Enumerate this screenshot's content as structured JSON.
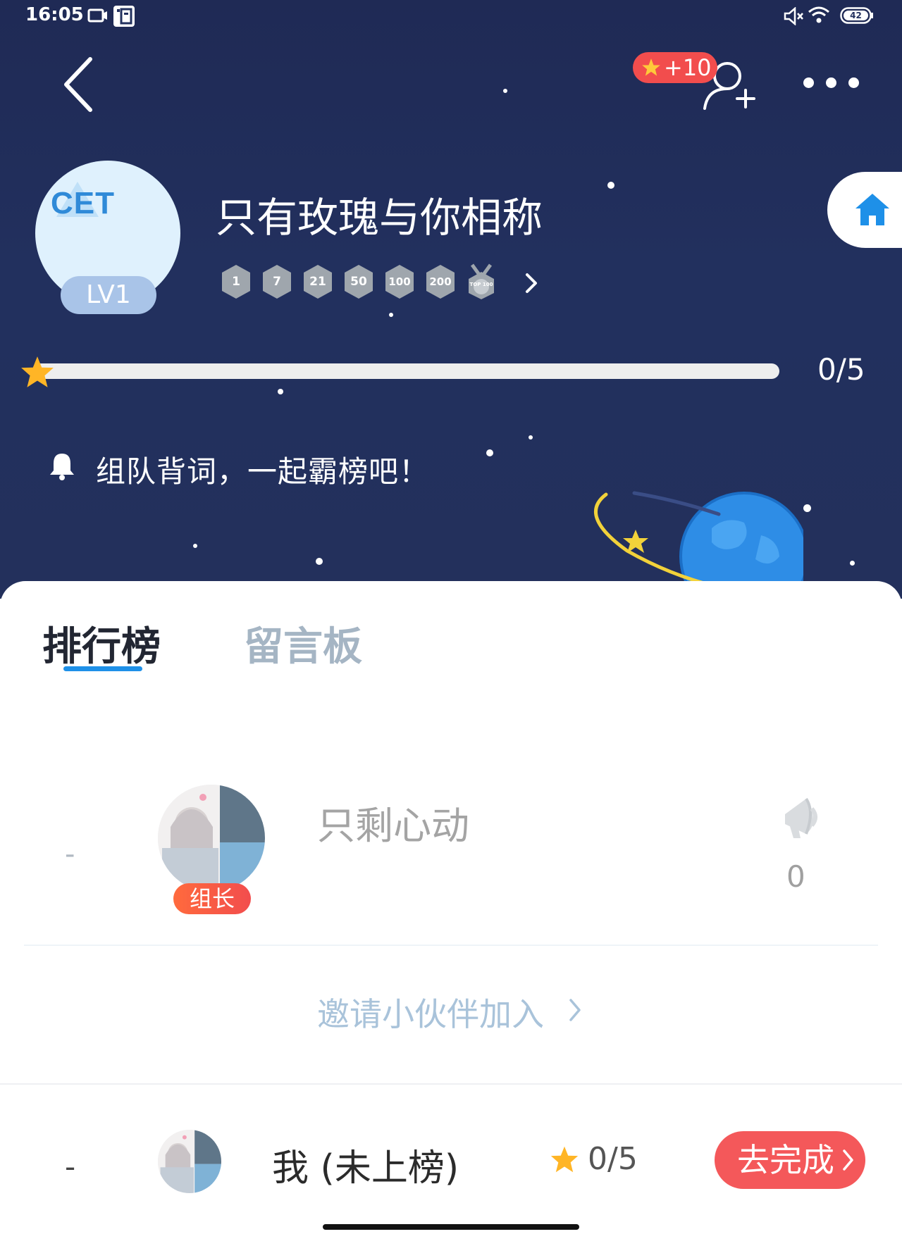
{
  "status_bar": {
    "time": "16:05",
    "battery": "42"
  },
  "header": {
    "reward_badge": "+10",
    "back_icon": "back-arrow-icon",
    "add_friend_icon": "add-user-icon",
    "more_icon": "more-dots-icon"
  },
  "group": {
    "avatar_text": "CET",
    "level": "LV1",
    "name": "只有玫瑰与你相称",
    "medals": [
      "1",
      "7",
      "21",
      "50",
      "100",
      "200",
      "TOP 100"
    ],
    "progress_text": "0/5",
    "progress_fraction": 0,
    "notice": "组队背词，一起霸榜吧！"
  },
  "tabs": [
    {
      "label": "排行榜",
      "active": true
    },
    {
      "label": "留言板",
      "active": false
    }
  ],
  "ranking": [
    {
      "position": "-",
      "name": "只剩心动",
      "role": "组长",
      "cheer_count": "0"
    }
  ],
  "invite": {
    "label": "邀请小伙伴加入"
  },
  "me": {
    "position": "-",
    "label": "我 (未上榜)",
    "score": "0/5",
    "button_label": "去完成"
  },
  "colors": {
    "hero_background": "#22305e",
    "accent_red": "#f4585a",
    "tab_underline": "#1e90e8",
    "star": "#ffb526"
  }
}
